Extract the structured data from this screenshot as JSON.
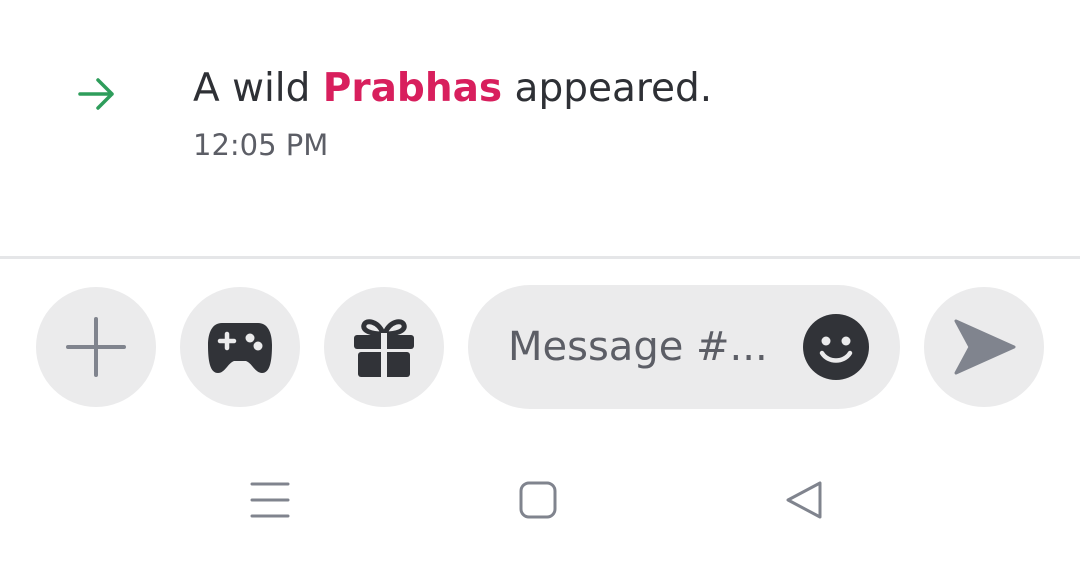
{
  "message": {
    "prefix": "A wild ",
    "username": "Prabhas",
    "suffix": " appeared.",
    "timestamp": "12:05 PM",
    "icon": "arrow-right-icon",
    "icon_color": "#2e9d5b",
    "username_color": "#d81f5d"
  },
  "composer": {
    "placeholder": "Message #...",
    "buttons": [
      "plus-icon",
      "gamepad-icon",
      "gift-icon",
      "emoji-icon",
      "send-icon"
    ]
  },
  "navbar": {
    "buttons": [
      "menu-icon",
      "home-icon",
      "back-icon"
    ]
  },
  "colors": {
    "button_bg": "#ebebec",
    "icon_dark": "#313338",
    "icon_grey": "#80848e",
    "divider": "#e5e6e8"
  }
}
